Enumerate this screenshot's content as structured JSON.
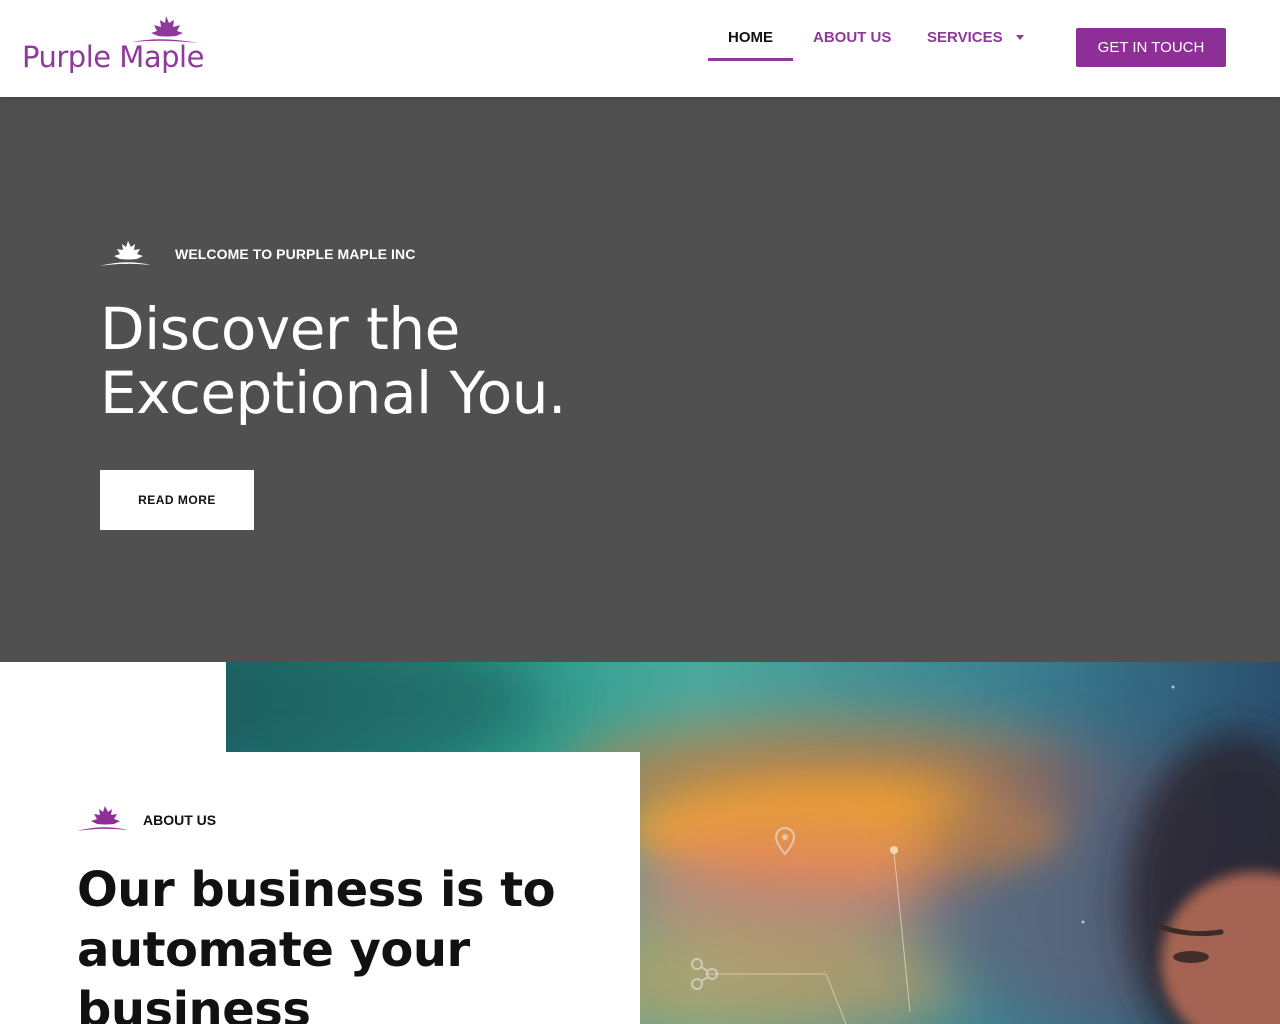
{
  "brand": {
    "name": "Purple Maple",
    "color": "#8e3a98",
    "logo_icon": "maple-leaf-icon"
  },
  "nav": {
    "items": [
      {
        "label": "HOME",
        "active": true
      },
      {
        "label": "ABOUT US",
        "active": false
      },
      {
        "label": "SERVICES",
        "active": false,
        "has_dropdown": true
      }
    ],
    "cta_label": "GET IN TOUCH",
    "cta_color": "#8e2f98"
  },
  "hero": {
    "background": "#505050",
    "eyebrow": "WELCOME TO PURPLE MAPLE INC",
    "title_line1": "Discover the",
    "title_line2": "Exceptional You.",
    "button_label": "READ MORE",
    "eyebrow_icon": "maple-leaf-icon"
  },
  "about": {
    "eyebrow": "ABOUT US",
    "heading": "Our business is to automate your business",
    "eyebrow_icon": "maple-leaf-icon",
    "image_icons": [
      "location-pin-icon",
      "share-nodes-icon"
    ]
  }
}
